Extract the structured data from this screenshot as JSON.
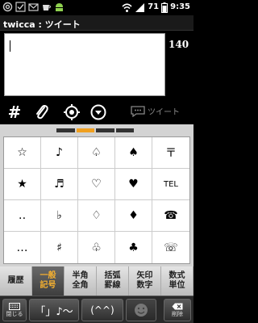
{
  "status_bar": {
    "battery_level": "71",
    "time": "9:35"
  },
  "title_bar": {
    "title": "twicca : ツイート"
  },
  "compose": {
    "char_counter": "140"
  },
  "toolbar": {
    "tweet_label": "ツイート"
  },
  "symbol_page_indicator": {
    "pages": 4,
    "active_page": 2
  },
  "symbol_grid": [
    [
      "☆",
      "♪",
      "♤",
      "♠",
      "〒"
    ],
    [
      "★",
      "♬",
      "♡",
      "♥",
      "TEL"
    ],
    [
      "‥",
      "♭",
      "♢",
      "♦",
      "☎"
    ],
    [
      "…",
      "♯",
      "♧",
      "♣",
      "☏"
    ]
  ],
  "categories": [
    {
      "label": "履歴",
      "active": false
    },
    {
      "label": "一般\n記号",
      "active": true
    },
    {
      "label": "半角\n全角",
      "active": false
    },
    {
      "label": "括弧\n罫線",
      "active": false
    },
    {
      "label": "矢印\n数字",
      "active": false
    },
    {
      "label": "数式\n単位",
      "active": false
    }
  ],
  "bottom_keys": {
    "close_label": "閉じる",
    "note_key": "「」♪〜",
    "face_key": "(^^)",
    "delete_label": "削除"
  },
  "colors": {
    "accent": "#f0a020",
    "background": "#000000"
  }
}
